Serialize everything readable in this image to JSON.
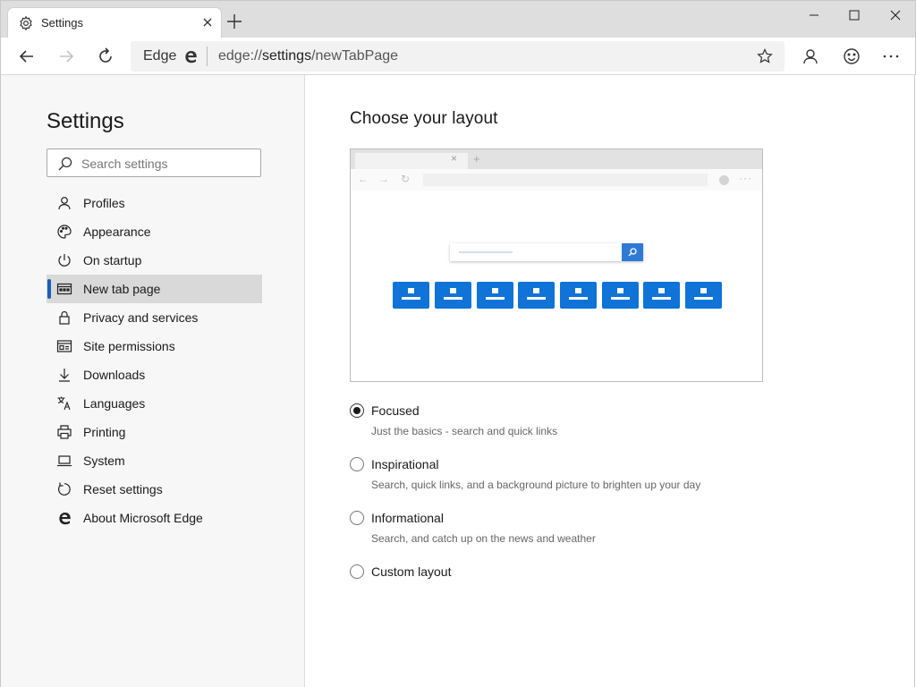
{
  "window": {
    "tab_title": "Settings",
    "tab_icon": "gear-icon"
  },
  "toolbar": {
    "site_identity": "Edge",
    "url_prefix": "edge://",
    "url_path": "settings",
    "url_suffix": "/newTabPage"
  },
  "sidebar": {
    "title": "Settings",
    "search_placeholder": "Search settings",
    "items": [
      {
        "label": "Profiles",
        "icon": "person-icon",
        "active": false
      },
      {
        "label": "Appearance",
        "icon": "palette-icon",
        "active": false
      },
      {
        "label": "On startup",
        "icon": "power-icon",
        "active": false
      },
      {
        "label": "New tab page",
        "icon": "new-tab-page-icon",
        "active": true
      },
      {
        "label": "Privacy and services",
        "icon": "lock-icon",
        "active": false
      },
      {
        "label": "Site permissions",
        "icon": "site-permissions-icon",
        "active": false
      },
      {
        "label": "Downloads",
        "icon": "download-icon",
        "active": false
      },
      {
        "label": "Languages",
        "icon": "languages-icon",
        "active": false
      },
      {
        "label": "Printing",
        "icon": "printer-icon",
        "active": false
      },
      {
        "label": "System",
        "icon": "laptop-icon",
        "active": false
      },
      {
        "label": "Reset settings",
        "icon": "reset-icon",
        "active": false
      },
      {
        "label": "About Microsoft Edge",
        "icon": "edge-logo-icon",
        "active": false
      }
    ]
  },
  "main": {
    "heading": "Choose your layout",
    "options": [
      {
        "label": "Focused",
        "description": "Just the basics - search and quick links",
        "selected": true
      },
      {
        "label": "Inspirational",
        "description": "Search, quick links, and a background picture to brighten up your day",
        "selected": false
      },
      {
        "label": "Informational",
        "description": "Search, and catch up on the news and weather",
        "selected": false
      },
      {
        "label": "Custom layout",
        "description": "",
        "selected": false
      }
    ]
  },
  "colors": {
    "accent": "#1a5fb4",
    "tile_blue": "#0f73d8",
    "sidebar_bg": "#f7f7f7",
    "active_item_bg": "#d9d9d9"
  }
}
